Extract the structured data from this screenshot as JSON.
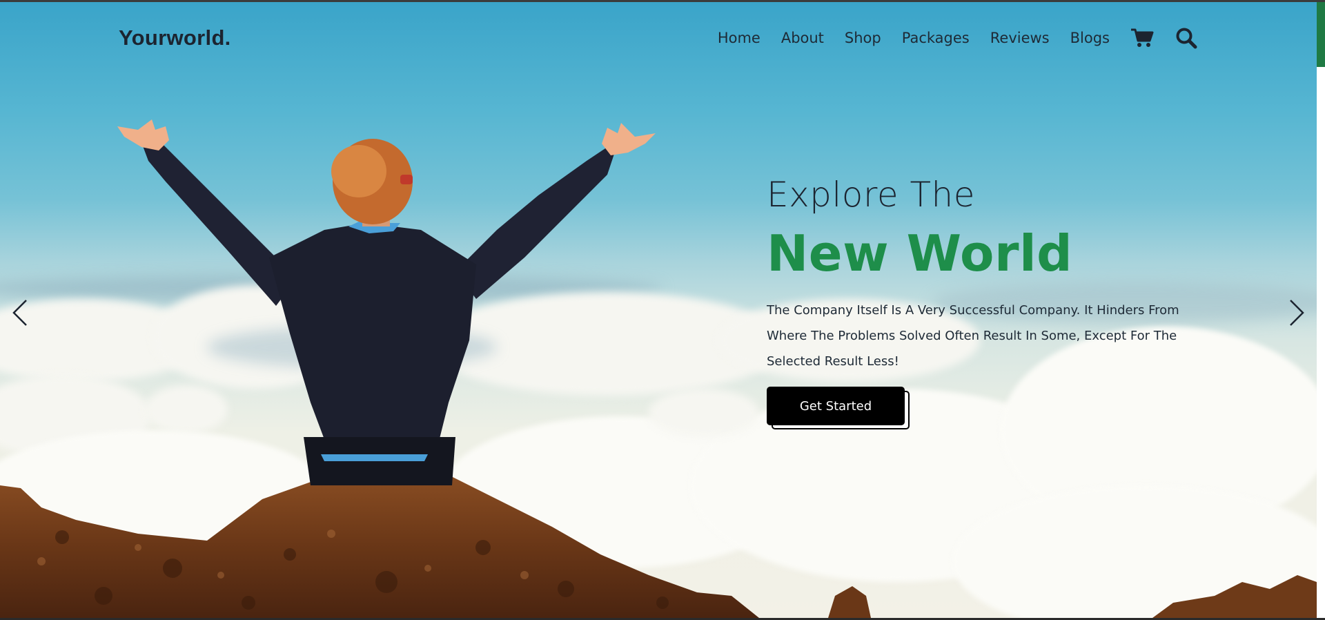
{
  "brand": {
    "logo": "Yourworld."
  },
  "nav": {
    "items": [
      "Home",
      "About",
      "Shop",
      "Packages",
      "Reviews",
      "Blogs"
    ],
    "cart_icon": "cart-icon",
    "search_icon": "search-icon"
  },
  "hero": {
    "line1": "Explore The",
    "line2": "New World",
    "description": "The Company Itself Is A Very Successful Company. It Hinders From Where The Problems Solved Often Result In Some, Except For The Selected Result Less!",
    "cta_label": "Get Started"
  },
  "carousel": {
    "prev_icon": "chevron-left-icon",
    "next_icon": "chevron-right-icon"
  },
  "colors": {
    "accent": "#1e8e4a",
    "text": "#1c2430",
    "button": "#000000"
  }
}
